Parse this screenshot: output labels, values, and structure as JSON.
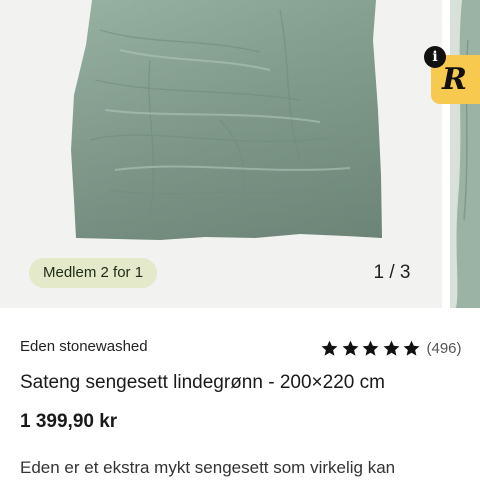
{
  "gallery": {
    "badge": "Medlem 2 for 1",
    "counter": "1 / 3",
    "image_description": "product-photo-green-duvet"
  },
  "widget": {
    "letter": "R",
    "info_symbol": "i"
  },
  "product": {
    "brand": "Eden stonewashed",
    "rating": 5,
    "review_count": "(496)",
    "title": "Sateng sengesett lindegrønn - 200×220 cm",
    "price": "1 399,90 kr",
    "description": "Eden er et ekstra mykt sengesett som virkelig kan"
  },
  "colors": {
    "badge_bg": "#e3e9c9",
    "widget_bg": "#f8c94f",
    "duvet_green": "#8aa596"
  }
}
